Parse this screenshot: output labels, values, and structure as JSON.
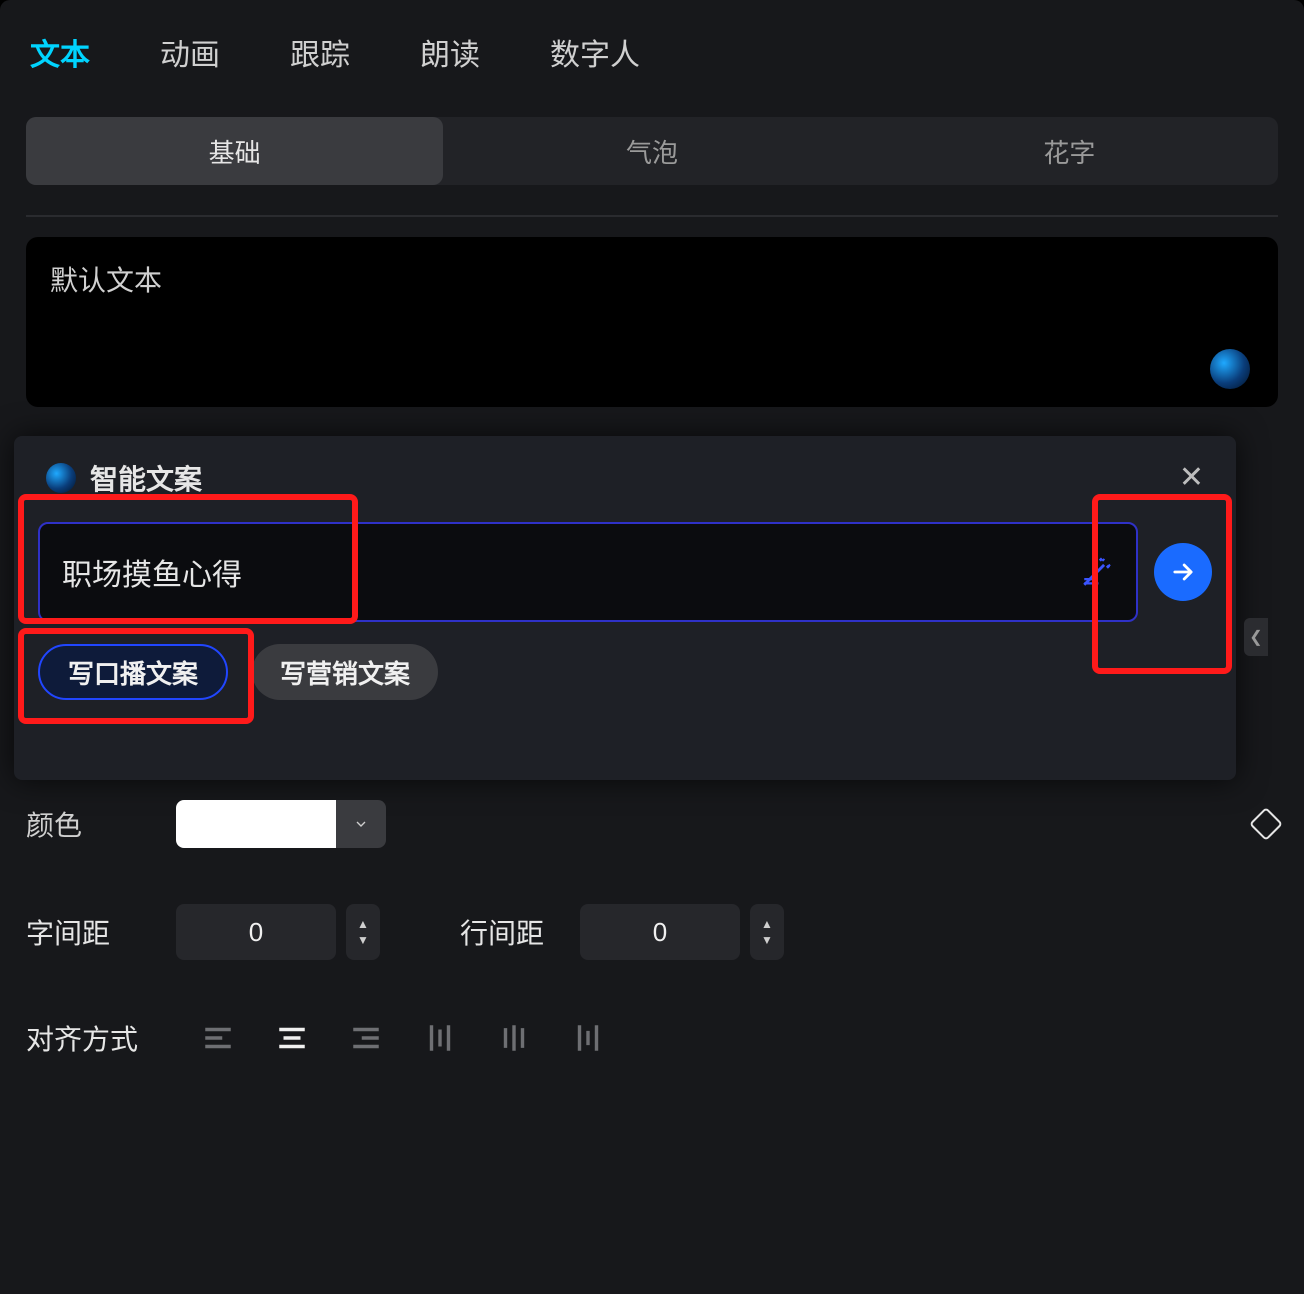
{
  "tabs_top": {
    "items": [
      "文本",
      "动画",
      "跟踪",
      "朗读",
      "数字人"
    ],
    "active_index": 0
  },
  "subtabs": {
    "items": [
      "基础",
      "气泡",
      "花字"
    ],
    "active_index": 0
  },
  "text_area": {
    "placeholder": "默认文本"
  },
  "smart": {
    "title": "智能文案",
    "input_value": "职场摸鱼心得",
    "chips": [
      "写口播文案",
      "写营销文案"
    ],
    "chip_selected_index": 0
  },
  "color_label": "颜色",
  "color_value": "#FFFFFF",
  "letter_spacing": {
    "label": "字间距",
    "value": "0"
  },
  "line_spacing": {
    "label": "行间距",
    "value": "0"
  },
  "align_label": "对齐方式",
  "align_active_index": 1
}
